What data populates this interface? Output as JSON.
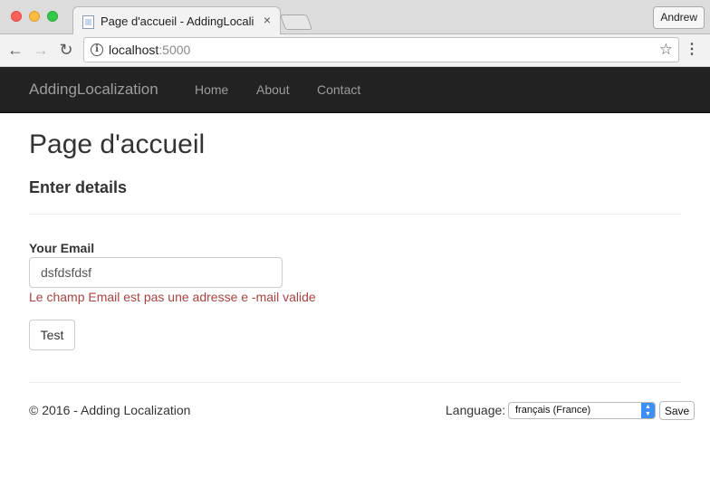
{
  "browser": {
    "tab_title": "Page d'accueil - AddingLocalization",
    "tab_close_glyph": "×",
    "profile_name": "Andrew",
    "url_host": "localhost",
    "url_port": ":5000"
  },
  "navbar": {
    "brand": "AddingLocalization",
    "links": [
      "Home",
      "About",
      "Contact"
    ]
  },
  "main": {
    "title": "Page d'accueil",
    "subtitle": "Enter details",
    "email_label": "Your Email",
    "email_value": "dsfdsfdsf",
    "error_message": "Le champ Email est pas une adresse e -mail valide",
    "test_button": "Test"
  },
  "footer": {
    "copyright": "© 2016 - Adding Localization",
    "language_label": "Language:",
    "language_selected": "français (France)",
    "save_button": "Save"
  },
  "colors": {
    "navbar_bg": "#222222",
    "navbar_text": "#9d9d9d",
    "error_text": "#a94442",
    "select_accent": "#3b8ff6"
  }
}
